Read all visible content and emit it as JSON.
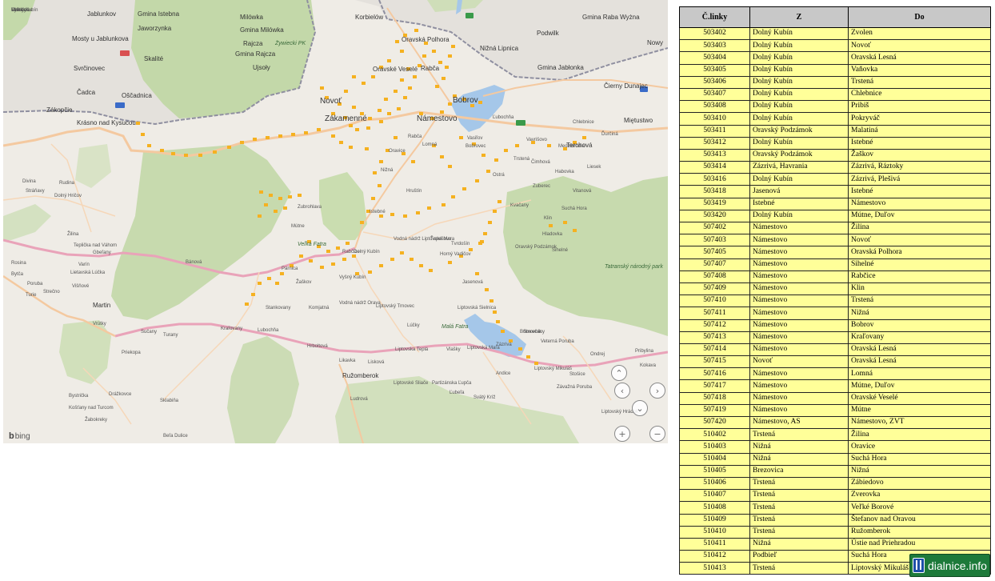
{
  "map": {
    "attribution": "bing",
    "controls": {
      "up": "⌃",
      "left": "‹",
      "right": "›",
      "down": "⌄",
      "zoom_in": "+",
      "zoom_out": "−"
    },
    "labels": [
      {
        "t": "Jablunkov",
        "c": "m"
      },
      {
        "t": "Gmina Istebna",
        "c": "m"
      },
      {
        "t": "Milówka",
        "c": "m"
      },
      {
        "t": "Korbielów",
        "c": "m"
      },
      {
        "t": "Podwilk",
        "c": "m"
      },
      {
        "t": "Gmina Raba Wyżna",
        "c": "m"
      },
      {
        "t": "Nowy",
        "c": "m"
      },
      {
        "t": "Jaworzynka",
        "c": "m"
      },
      {
        "t": "Gmina Milówka",
        "c": "m"
      },
      {
        "t": "Mosty u Jablunkova",
        "c": "m"
      },
      {
        "t": "Rajcza",
        "c": "m"
      },
      {
        "t": "Żywiecki PK",
        "c": "g"
      },
      {
        "t": "Gmina Rajcza",
        "c": "m"
      },
      {
        "t": "Oravská Polhora",
        "c": "m"
      },
      {
        "t": "Nižná Lipnica",
        "c": "m"
      },
      {
        "t": "Skalité",
        "c": "m"
      },
      {
        "t": "Svrčinovec",
        "c": "m"
      },
      {
        "t": "Ujsoły",
        "c": "m"
      },
      {
        "t": "Oravské Veselé",
        "c": "m"
      },
      {
        "t": "Rabča",
        "c": "m"
      },
      {
        "t": "Gmina Jabłonka",
        "c": "m"
      },
      {
        "t": "Čierny Dunajec",
        "c": "m"
      },
      {
        "t": "Čadca",
        "c": "m"
      },
      {
        "t": "Oščadnica",
        "c": "m"
      },
      {
        "t": "Novoť",
        "c": "l"
      },
      {
        "t": "Bobrov",
        "c": "l"
      },
      {
        "t": "Zákopčie",
        "c": "m"
      },
      {
        "t": "Zákamenné",
        "c": "l"
      },
      {
        "t": "Námestovo",
        "c": "l"
      },
      {
        "t": "Krásno nad Kysucou",
        "c": "m"
      },
      {
        "t": "Miętustwo",
        "c": "m"
      },
      {
        "t": "Rabča",
        "c": "s"
      },
      {
        "t": "Lomná",
        "c": "s"
      },
      {
        "t": "Bobrovec",
        "c": "s"
      },
      {
        "t": "Trstená",
        "c": "s"
      },
      {
        "t": "Terchová",
        "c": "m"
      },
      {
        "t": "Tatranský národný park",
        "c": "g"
      },
      {
        "t": "Teplička nad Váhom",
        "c": "s"
      },
      {
        "t": "Gbeľany",
        "c": "s"
      },
      {
        "t": "Dolný Kubín",
        "c": "s"
      },
      {
        "t": "Tvrdošín",
        "c": "s"
      },
      {
        "t": "Varín",
        "c": "s"
      },
      {
        "t": "Párnica",
        "c": "s"
      },
      {
        "t": "Žaškov",
        "c": "s"
      },
      {
        "t": "Vyšný Kubín",
        "c": "s"
      },
      {
        "t": "Istebné",
        "c": "s"
      },
      {
        "t": "Ružomberok",
        "c": "m"
      },
      {
        "t": "Stankovany",
        "c": "s"
      },
      {
        "t": "Komjatná",
        "c": "s"
      },
      {
        "t": "Lúčky",
        "c": "s"
      },
      {
        "t": "Liptovský Trnovec",
        "c": "s"
      },
      {
        "t": "Bobrovník",
        "c": "s"
      },
      {
        "t": "Liptovská Sielnica",
        "c": "s"
      },
      {
        "t": "Liptovská Mara",
        "c": "s"
      },
      {
        "t": "Liptovský Mikuláš",
        "c": "s"
      },
      {
        "t": "Martin",
        "c": "m"
      },
      {
        "t": "Vrútky",
        "c": "s"
      },
      {
        "t": "Sučany",
        "c": "s"
      },
      {
        "t": "Turany",
        "c": "s"
      },
      {
        "t": "Kraľovany",
        "c": "s"
      },
      {
        "t": "Priekopa",
        "c": "s"
      },
      {
        "t": "Lubochňa",
        "c": "s"
      },
      {
        "t": "Hrboltová",
        "c": "s"
      },
      {
        "t": "Likavka",
        "c": "s"
      },
      {
        "t": "Liptovská Teplá",
        "c": "s"
      },
      {
        "t": "Vlašky",
        "c": "s"
      },
      {
        "t": "Ondrej",
        "c": "s"
      },
      {
        "t": "Pribylina",
        "c": "s"
      },
      {
        "t": "Kokava",
        "c": "s"
      },
      {
        "t": "Bystrička",
        "c": "s"
      },
      {
        "t": "Drážkovce",
        "c": "s"
      },
      {
        "t": "Košťany nad Turcom",
        "c": "s"
      },
      {
        "t": "Sklabiňa",
        "c": "s"
      },
      {
        "t": "Ludrová",
        "c": "s"
      },
      {
        "t": "Partizánska Ľupča",
        "c": "s"
      },
      {
        "t": "Ľubeľa",
        "c": "s"
      },
      {
        "t": "Svätý Kríž",
        "c": "s"
      },
      {
        "t": "Andice",
        "c": "s"
      },
      {
        "t": "Stošice",
        "c": "s"
      },
      {
        "t": "Závažná Poruba",
        "c": "s"
      },
      {
        "t": "Liptovský Hrádok",
        "c": "s"
      },
      {
        "t": "Žabokreky",
        "c": "s"
      },
      {
        "t": "Beľa Dulice",
        "c": "s"
      },
      {
        "t": "Liptovské Sliače",
        "c": "s"
      },
      {
        "t": "Veterná Poruba",
        "c": "s"
      },
      {
        "t": "Smrečany",
        "c": "s"
      },
      {
        "t": "Lisková",
        "c": "s"
      },
      {
        "t": "Turie",
        "c": "s"
      },
      {
        "t": "Poruba",
        "c": "s"
      },
      {
        "t": "Rosina",
        "c": "s"
      },
      {
        "t": "Lietavská Lúčka",
        "c": "s"
      },
      {
        "t": "Strečno",
        "c": "s"
      },
      {
        "t": "Višňové",
        "c": "s"
      },
      {
        "t": "Stráňavy",
        "c": "s"
      },
      {
        "t": "Divina",
        "c": "s"
      },
      {
        "t": "Rudina",
        "c": "s"
      },
      {
        "t": "Bytča",
        "c": "s"
      },
      {
        "t": "Žilina",
        "c": "s"
      },
      {
        "t": "Dolný Hričov",
        "c": "s"
      },
      {
        "t": "Bánová",
        "c": "s"
      },
      {
        "t": "Horný Vadičov",
        "c": "s"
      },
      {
        "t": "Zázrivá",
        "c": "s"
      },
      {
        "t": "Malá Fatra",
        "c": "g"
      },
      {
        "t": "Veľká Fatra",
        "c": "g"
      },
      {
        "t": "Vodná nádrž Liptovská Mara",
        "c": "s"
      },
      {
        "t": "Vodná nádrž Orava",
        "c": "s"
      },
      {
        "t": "Oravský Podzámok",
        "c": "s"
      },
      {
        "t": "Medzibrodie",
        "c": "s"
      },
      {
        "t": "Vavrišovo",
        "c": "s"
      },
      {
        "t": "Kvačany",
        "c": "s"
      },
      {
        "t": "Ostrá",
        "c": "s"
      },
      {
        "t": "Nižná",
        "c": "s"
      },
      {
        "t": "Hruštín",
        "c": "s"
      },
      {
        "t": "Vasiľov",
        "c": "s"
      },
      {
        "t": "Ďurčiná",
        "c": "s"
      },
      {
        "t": "Chlebnice",
        "c": "s"
      },
      {
        "t": "Sihelné",
        "c": "s"
      },
      {
        "t": "Klin",
        "c": "s"
      },
      {
        "t": "Vitanová",
        "c": "s"
      },
      {
        "t": "Habovka",
        "c": "s"
      },
      {
        "t": "Zuberec",
        "c": "s"
      },
      {
        "t": "Suchá Hora",
        "c": "s"
      },
      {
        "t": "Hladovka",
        "c": "s"
      },
      {
        "t": "Čimhová",
        "c": "s"
      },
      {
        "t": "Liesek",
        "c": "s"
      },
      {
        "t": "Oravice",
        "c": "s"
      },
      {
        "t": "Rabčice",
        "c": "s"
      },
      {
        "t": "Mútne",
        "c": "s"
      },
      {
        "t": "Zubrohlava",
        "c": "s"
      },
      {
        "t": "Ťapešovo",
        "c": "s"
      },
      {
        "t": "Ľubochňa",
        "c": "s"
      },
      {
        "t": "Jasenová",
        "c": "s"
      },
      {
        "t": "Leštiny",
        "c": "s"
      },
      {
        "t": "Malatiná",
        "c": "s"
      },
      {
        "t": "Chlebnice",
        "c": "s"
      },
      {
        "t": "Vyšný Kubín",
        "c": "s"
      }
    ]
  },
  "table": {
    "headers": [
      "Č.linky",
      "Z",
      "Do"
    ],
    "rows": [
      [
        "503402",
        "Dolný Kubín",
        "Zvolen"
      ],
      [
        "503403",
        "Dolný Kubín",
        "Novoť"
      ],
      [
        "503404",
        "Dolný Kubín",
        "Oravská Lesná"
      ],
      [
        "503405",
        "Dolný Kubín",
        "Vaňovka"
      ],
      [
        "503406",
        "Dolný Kubín",
        "Trstená"
      ],
      [
        "503407",
        "Dolný Kubín",
        "Chlebnice"
      ],
      [
        "503408",
        "Dolný Kubín",
        "Pribiš"
      ],
      [
        "503410",
        "Dolný Kubín",
        "Pokryváč"
      ],
      [
        "503411",
        "Oravský Podzámok",
        "Malatiná"
      ],
      [
        "503412",
        "Dolný Kubín",
        "Istebné"
      ],
      [
        "503413",
        "Oravský Podzámok",
        "Žaškov"
      ],
      [
        "503414",
        "Zázrivá, Havrania",
        "Zázrivá, Ráztoky"
      ],
      [
        "503416",
        "Dolný Kubín",
        "Zázrivá, Plešivá"
      ],
      [
        "503418",
        "Jasenová",
        "Istebné"
      ],
      [
        "503419",
        "Istebné",
        "Námestovo"
      ],
      [
        "503420",
        "Dolný Kubín",
        "Mútne, Duľov"
      ],
      [
        "507402",
        "Námestovo",
        "Žilina"
      ],
      [
        "507403",
        "Námestovo",
        "Novoť"
      ],
      [
        "507405",
        "Námestovo",
        "Oravská Polhora"
      ],
      [
        "507407",
        "Námestovo",
        "Sihelné"
      ],
      [
        "507408",
        "Námestovo",
        "Rabčice"
      ],
      [
        "507409",
        "Námestovo",
        "Klin"
      ],
      [
        "507410",
        "Námestovo",
        "Trstená"
      ],
      [
        "507411",
        "Námestovo",
        "Nižná"
      ],
      [
        "507412",
        "Námestovo",
        "Bobrov"
      ],
      [
        "507413",
        "Námestovo",
        "Kraľovany"
      ],
      [
        "507414",
        "Námestovo",
        "Oravská Lesná"
      ],
      [
        "507415",
        "Novoť",
        "Oravská Lesná"
      ],
      [
        "507416",
        "Námestovo",
        "Lomná"
      ],
      [
        "507417",
        "Námestovo",
        "Mútne, Duľov"
      ],
      [
        "507418",
        "Námestovo",
        "Oravské Veselé"
      ],
      [
        "507419",
        "Námestovo",
        "Mútne"
      ],
      [
        "507420",
        "Námestovo, AS",
        "Námestovo, ZVT"
      ],
      [
        "510402",
        "Trstená",
        "Žilina"
      ],
      [
        "510403",
        "Nižná",
        "Oravice"
      ],
      [
        "510404",
        "Nižná",
        "Suchá Hora"
      ],
      [
        "510405",
        "Brezovica",
        "Nižná"
      ],
      [
        "510406",
        "Trstená",
        "Zábiedovo"
      ],
      [
        "510407",
        "Trstená",
        "Zverovka"
      ],
      [
        "510408",
        "Trstená",
        "Veľké Borové"
      ],
      [
        "510409",
        "Trstená",
        "Štefanov nad Oravou"
      ],
      [
        "510410",
        "Trstená",
        "Ružomberok"
      ],
      [
        "510411",
        "Nižná",
        "Ústie nad Priehradou"
      ],
      [
        "510412",
        "Podbieľ",
        "Suchá Hora"
      ],
      [
        "510413",
        "Trstená",
        "Liptovský Mikuláš"
      ]
    ]
  },
  "watermark": {
    "text": "dialnice.info"
  }
}
